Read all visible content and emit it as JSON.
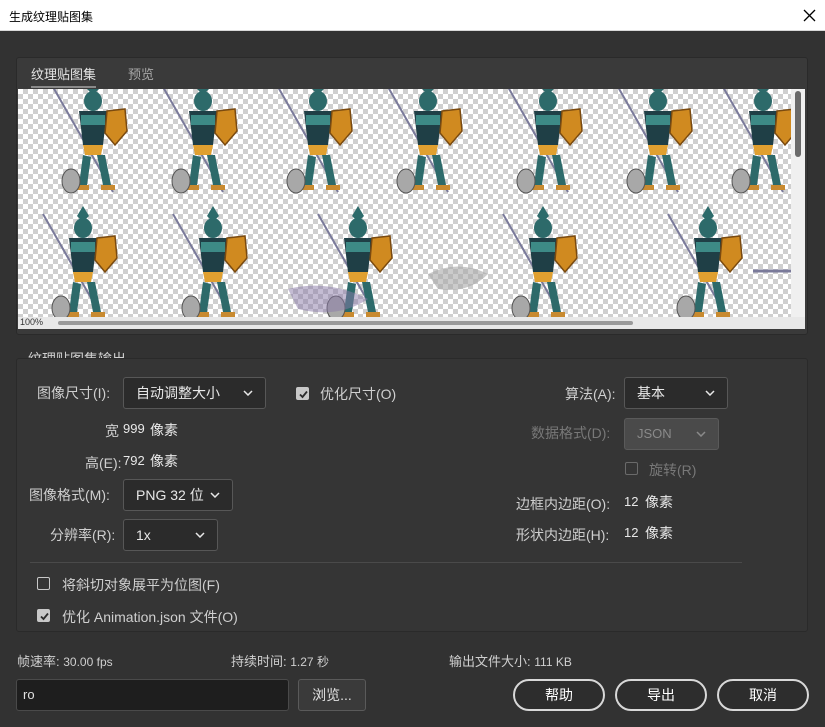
{
  "window": {
    "title": "生成纹理贴图集"
  },
  "tabs": [
    {
      "label": "纹理贴图集",
      "active": true
    },
    {
      "label": "预览",
      "active": false
    }
  ],
  "preview": {
    "zoom": "100%"
  },
  "output_section": {
    "title": "纹理贴图集输出",
    "image_size": {
      "label": "图像尺寸(I):",
      "value": "自动调整大小"
    },
    "optimize_size": {
      "label": "优化尺寸(O)",
      "checked": true
    },
    "width": {
      "label": "宽",
      "value": "999",
      "unit": "像素"
    },
    "height": {
      "label": "高(E):",
      "value": "792",
      "unit": "像素"
    },
    "image_format": {
      "label": "图像格式(M):",
      "value": "PNG 32 位"
    },
    "resolution": {
      "label": "分辨率(R):",
      "value": "1x"
    },
    "algorithm": {
      "label": "算法(A):",
      "value": "基本"
    },
    "data_format": {
      "label": "数据格式(D):",
      "value": "JSON"
    },
    "rotate": {
      "label": "旋转(R)",
      "checked": false
    },
    "border_padding": {
      "label": "边框内边距(O):",
      "value": "12",
      "unit": "像素"
    },
    "shape_padding": {
      "label": "形状内边距(H):",
      "value": "12",
      "unit": "像素"
    },
    "flatten_bevel": {
      "label": "将斜切对象展平为位图(F)",
      "checked": false
    },
    "optimize_json": {
      "label": "优化 Animation.json 文件(O)",
      "checked": true
    }
  },
  "stats": {
    "framerate": {
      "label": "帧速率:",
      "value": "30.00 fps"
    },
    "duration": {
      "label": "持续时间:",
      "value": "1.27 秒"
    },
    "filesize": {
      "label": "输出文件大小:",
      "value": "111 KB"
    }
  },
  "footer": {
    "path_value": "ro",
    "browse_label": "浏览...",
    "help_label": "帮助",
    "export_label": "导出",
    "cancel_label": "取消"
  },
  "colors": {
    "teal": "#2d6a6a",
    "gold": "#e0a030",
    "armor_dark": "#1f3f46"
  }
}
